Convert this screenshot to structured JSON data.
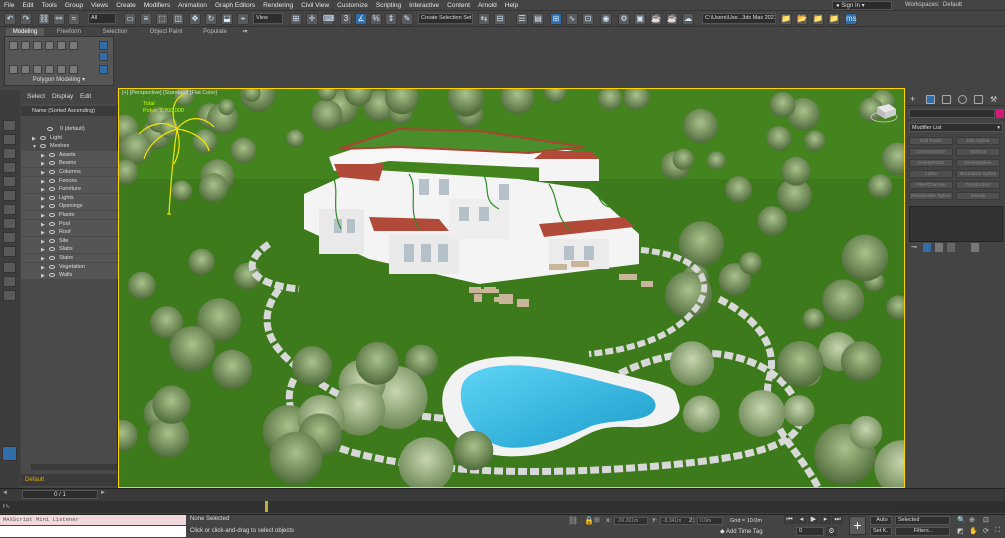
{
  "menu": [
    "File",
    "Edit",
    "Tools",
    "Group",
    "Views",
    "Create",
    "Modifiers",
    "Animation",
    "Graph Editors",
    "Rendering",
    "Civil View",
    "Customize",
    "Scripting",
    "Interactive",
    "Content",
    "Arnold",
    "Help"
  ],
  "account": {
    "signin": "Sign In",
    "workspaces_label": "Workspaces:",
    "workspace": "Default"
  },
  "toolbar": {
    "filter": "All",
    "view": "View",
    "selection_set": "Create Selection Set",
    "path": "C:\\Users\\Use...3ds Max 2021"
  },
  "ribbon": {
    "tabs": [
      "Modeling",
      "Freeform",
      "Selection",
      "Object Paint",
      "Populate"
    ],
    "panel_label": "Polygon Modeling ▾"
  },
  "scene_explorer": {
    "menu": [
      "Select",
      "Display",
      "Edit"
    ],
    "header": "Name (Sorted Ascending)",
    "items": [
      {
        "name": "0 (default)",
        "level": 2
      },
      {
        "name": "Light",
        "level": 1
      },
      {
        "name": "Meshes",
        "level": 1
      },
      {
        "name": "Assets",
        "level": 3
      },
      {
        "name": "Beams",
        "level": 3
      },
      {
        "name": "Columns",
        "level": 3
      },
      {
        "name": "Fences",
        "level": 3
      },
      {
        "name": "Furniture",
        "level": 3
      },
      {
        "name": "Lights",
        "level": 3
      },
      {
        "name": "Openings",
        "level": 3
      },
      {
        "name": "Plants",
        "level": 3
      },
      {
        "name": "Pool",
        "level": 3
      },
      {
        "name": "Roof",
        "level": 3
      },
      {
        "name": "Site",
        "level": 3
      },
      {
        "name": "Slabs",
        "level": 3
      },
      {
        "name": "Stairs",
        "level": 3
      },
      {
        "name": "Vegetation",
        "level": 3
      },
      {
        "name": "Walls",
        "level": 3
      }
    ],
    "layer": "Default"
  },
  "viewport": {
    "label": "[+] [Perspective] [Standard] [Flat Color]",
    "stats1": "Total",
    "stats2": "Polys: 3,700,000"
  },
  "command_panel": {
    "modifier_list": "Modifier List",
    "buttons": [
      "Edit Patch",
      "Edit Spline",
      "CrossSection",
      "Surface",
      "DeletePatch",
      "DeleteSpline",
      "Lathe",
      "Normalize Spline",
      "Fillet/Chamfer",
      "Trim/Extend",
      "Renderable Spline",
      "Sweep"
    ]
  },
  "timeline": {
    "frame": "0 / 1"
  },
  "status": {
    "maxscript": "MAXScript Mini Listener",
    "selection": "None Selected",
    "prompt": "Click or click-and-drag to select objects",
    "x_label": "X:",
    "y_label": "Y:",
    "z_label": "Z:",
    "x": "-36.201m",
    "y": "-8.341m",
    "z": "0.0m",
    "grid": "Grid = 10.0m",
    "add_time_tag": "Add Time Tag",
    "auto": "Auto",
    "selected": "Selected",
    "set_k": "Set K.",
    "filters": "Filters..."
  },
  "colors": {
    "accent": "#2f6ea8",
    "viewport_border": "#ffd400",
    "grass": "#3d7a1b",
    "pool": "#2bb5e0",
    "key": "#bfae3a"
  }
}
